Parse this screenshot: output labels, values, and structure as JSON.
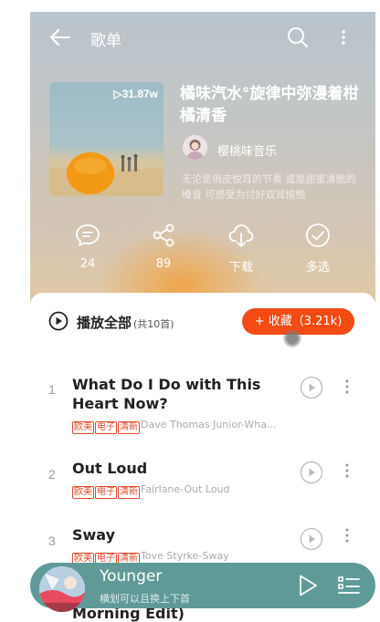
{
  "header": {
    "title": "歌单"
  },
  "playlist": {
    "play_count": "▷31.87w",
    "name": "橘味汽水°旋律中弥漫着柑橘清香",
    "creator": "樱桃味音乐",
    "description": "无论是俏皮悦耳的节奏 或是甜蜜清脆的嗓音 可感受为讨好双耳愉悦"
  },
  "actions": [
    {
      "icon": "comment-icon",
      "label": "24"
    },
    {
      "icon": "share-icon",
      "label": "89"
    },
    {
      "icon": "download-icon",
      "label": "下载"
    },
    {
      "icon": "multi-select-icon",
      "label": "多选"
    }
  ],
  "list": {
    "play_all_label": "播放全部",
    "count_label": "(共10首)",
    "collect_label": "+ 收藏（3.21k)"
  },
  "songs": [
    {
      "index": "1",
      "title": "What Do I Do with This Heart Now?",
      "tags": [
        "欧美",
        "电子",
        "清新"
      ],
      "artist": "Dave Thomas Junior-Wha..."
    },
    {
      "index": "2",
      "title": "Out Loud",
      "tags": [
        "欧美",
        "电子",
        "清新"
      ],
      "artist": "Fairlane-Out Loud"
    },
    {
      "index": "3",
      "title": "Sway",
      "tags": [
        "欧美",
        "电子",
        "清新"
      ],
      "artist": "Tove Styrke-Sway"
    }
  ],
  "peek_song_title": "Morning Edit)",
  "now_playing": {
    "title": "Younger",
    "subtitle": "横划可以且换上下首"
  },
  "colors": {
    "accent": "#f34b14",
    "tag": "#e04b2a",
    "player_bar": "#5f9a98"
  }
}
